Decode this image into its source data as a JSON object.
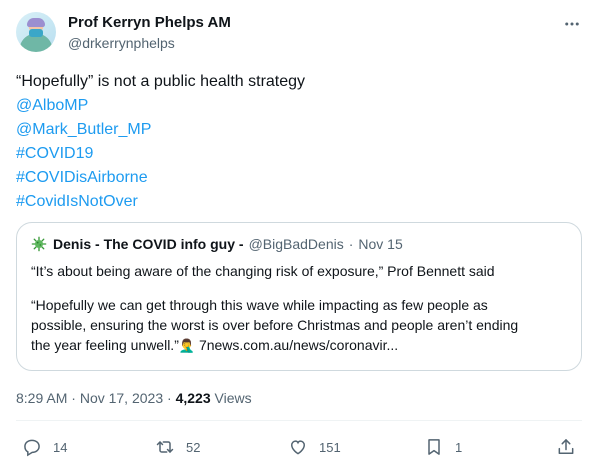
{
  "author": {
    "name": "Prof Kerryn Phelps AM",
    "handle": "@drkerrynphelps"
  },
  "tweet": {
    "lines": [
      {
        "text": "“Hopefully” is not a public health strategy",
        "is_link": false
      },
      {
        "text": "@AlboMP",
        "is_link": true
      },
      {
        "text": "@Mark_Butler_MP",
        "is_link": true
      },
      {
        "text": "#COVID19",
        "is_link": true
      },
      {
        "text": "#COVIDisAirborne",
        "is_link": true
      },
      {
        "text": "#CovidIsNotOver",
        "is_link": true
      }
    ]
  },
  "quote": {
    "icon": "virus-icon",
    "name": "Denis - The COVID info guy -",
    "handle": "@BigBadDenis",
    "separator": "·",
    "date": "Nov 15",
    "line1": "“It’s about being aware of the changing risk of exposure,” Prof Bennett said",
    "line2": "“Hopefully we can get through this wave while impacting as few people as",
    "line3": "possible, ensuring the worst is over before Christmas and people aren’t ending",
    "line4_text": "the year feeling unwell.”",
    "line4_emoji": "🤦‍♂️",
    "line4_link": "7news.com.au/news/coronavir..."
  },
  "meta": {
    "time": "8:29 AM",
    "separator": "·",
    "date": "Nov 17, 2023",
    "separator2": "·",
    "views_count": "4,223",
    "views_label": "Views"
  },
  "actions": {
    "replies": "14",
    "reposts": "52",
    "likes": "151",
    "bookmarks": "1"
  },
  "colors": {
    "link": "#1d9bf0",
    "secondary_text": "#536471",
    "primary_text": "#0f1419",
    "border": "#cfd9de"
  }
}
